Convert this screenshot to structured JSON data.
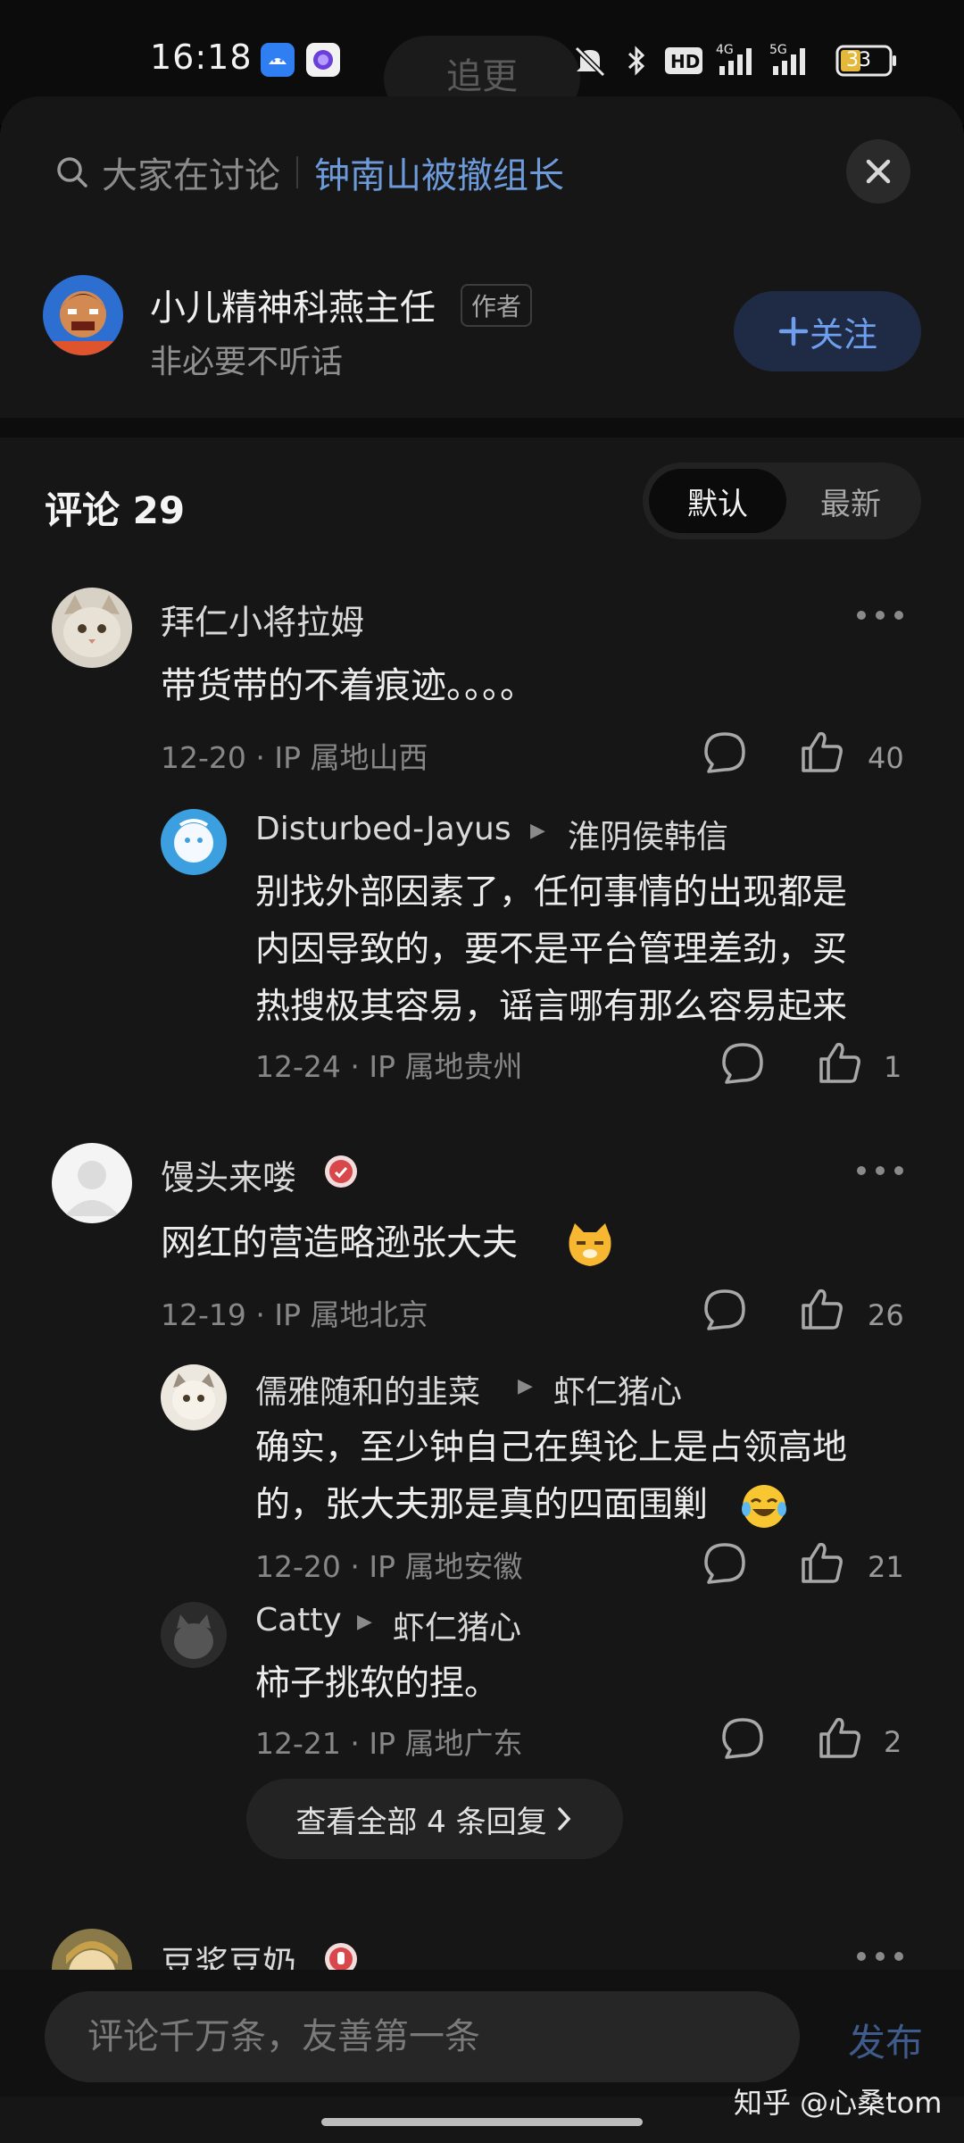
{
  "status_bar": {
    "time": "16:18",
    "battery": "33"
  },
  "behind_tab": {
    "label": "追更"
  },
  "search": {
    "prefix": "大家在讨论",
    "topic": "钟南山被撤组长"
  },
  "author": {
    "name": "小儿精神科燕主任",
    "badge": "作者",
    "subtitle": "非必要不听话",
    "follow_label": "关注"
  },
  "comments_header": {
    "title": "评论 29",
    "sort_default": "默认",
    "sort_latest": "最新"
  },
  "comments": [
    {
      "user": "拜仁小将拉姆",
      "text": "带货带的不着痕迹。。。。",
      "meta": "12-20 · IP 属地山西",
      "likes": "40",
      "replies": [
        {
          "user": "Disturbed-Jayus",
          "reply_to": "淮阴侯韩信",
          "text_lines": [
            "别找外部因素了，任何事情的出现都是",
            "内因导致的，要不是平台管理差劲，买",
            "热搜极其容易，谣言哪有那么容易起来"
          ],
          "meta": "12-24 · IP 属地贵州",
          "likes": "1"
        }
      ]
    },
    {
      "user": "馒头来喽",
      "text": "网红的营造略逊张大夫",
      "meta": "12-19 · IP 属地北京",
      "likes": "26",
      "replies": [
        {
          "user": "儒雅随和的韭菜",
          "reply_to": "虾仁猪心",
          "text_lines": [
            "确实，至少钟自己在舆论上是占领高地",
            "的，张大夫那是真的四面围剿"
          ],
          "meta": "12-20 · IP 属地安徽",
          "likes": "21"
        },
        {
          "user": "Catty",
          "reply_to": "虾仁猪心",
          "text_lines": [
            "柿子挑软的捏。"
          ],
          "meta": "12-21 · IP 属地广东",
          "likes": "2"
        }
      ],
      "view_all": "查看全部 4 条回复"
    },
    {
      "user": "豆浆豆奶"
    }
  ],
  "bottom_bar": {
    "placeholder": "评论千万条，友善第一条",
    "publish": "发布",
    "watermark": "知乎 @心桑tom"
  },
  "colors": {
    "accent": "#6e9fee",
    "background": "#161616",
    "follow_bg": "#1f2b45"
  },
  "icons": [
    "android-app-icon",
    "assistant-app-icon",
    "mute-icon",
    "bluetooth-icon",
    "hd-icon",
    "signal-4g-icon",
    "signal-5g-icon",
    "battery-icon",
    "search-icon",
    "close-icon",
    "plus-icon",
    "more-icon",
    "comment-icon",
    "like-icon",
    "reply-arrow-icon",
    "chevron-right-icon",
    "cat-emoji-icon",
    "laugh-cry-emoji-icon",
    "badge-icon"
  ]
}
